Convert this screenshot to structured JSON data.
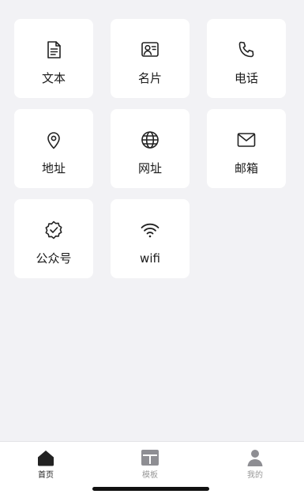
{
  "tiles": [
    {
      "label": "文本",
      "icon": "document-icon"
    },
    {
      "label": "名片",
      "icon": "contact-card-icon"
    },
    {
      "label": "电话",
      "icon": "phone-icon"
    },
    {
      "label": "地址",
      "icon": "location-pin-icon"
    },
    {
      "label": "网址",
      "icon": "globe-icon"
    },
    {
      "label": "邮箱",
      "icon": "mail-icon"
    },
    {
      "label": "公众号",
      "icon": "verified-badge-icon"
    },
    {
      "label": "wifi",
      "icon": "wifi-icon"
    }
  ],
  "tabbar": {
    "home": {
      "label": "首页",
      "icon": "home-icon"
    },
    "template": {
      "label": "模板",
      "icon": "template-icon"
    },
    "mine": {
      "label": "我的",
      "icon": "user-icon"
    }
  },
  "colors": {
    "background": "#f2f2f5",
    "tile": "#ffffff",
    "active_text": "#222222",
    "inactive_text": "#999999"
  }
}
